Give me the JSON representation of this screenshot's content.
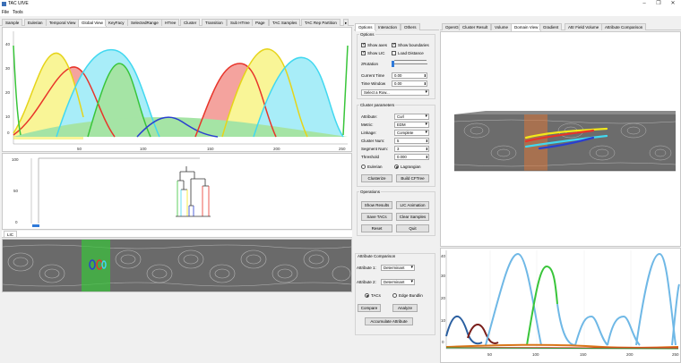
{
  "window": {
    "title": "TAC UIVE",
    "minimize": "–",
    "maximize": "❐",
    "close": "✕"
  },
  "menu": {
    "file": "File",
    "tools": "Tools"
  },
  "left_tabs": [
    "Sample",
    "Eulerian",
    "Temporal View",
    "Global View",
    "KeyFacy",
    "SelectedRange",
    "HTree",
    "Cluster",
    "Transition",
    "Sub HTree",
    "Page",
    "TAC Samples",
    "TAC Rep Partition"
  ],
  "left_tabs_more": "▸",
  "global_chart": {
    "y_ticks": [
      "40",
      "30",
      "20",
      "10",
      "0"
    ],
    "x_ticks": [
      "50",
      "100",
      "150",
      "200",
      "250"
    ]
  },
  "dendro_chart": {
    "y_ticks": [
      "100",
      "50",
      "0"
    ]
  },
  "lic": {
    "label": "LIC"
  },
  "options_tabs": [
    "Options",
    "Interaction",
    "Others"
  ],
  "options": {
    "group_title": "Options",
    "show_axes": "Show axes",
    "show_boundaries": "Show boundaries",
    "show_lic": "Show LIC",
    "load_distance": "Load Distance",
    "z_rotation_label": "zRotation",
    "current_time_label": "Current Time",
    "current_time_value": "0.00",
    "time_window_label": "Time Window",
    "time_window_value": "0.00",
    "select_row": "Select a Row..."
  },
  "cluster": {
    "group_title": "Cluster parameters",
    "attribute_label": "Attribute:",
    "attribute_value": "Curl",
    "metric_label": "Metric:",
    "metric_value": "EDM",
    "linkage_label": "Linkage:",
    "linkage_value": "Complete",
    "cluster_num_label": "Cluster Num:",
    "cluster_num_value": "5",
    "segment_num_label": "Segment Num:",
    "segment_num_value": "3",
    "threshold_label": "Threshold",
    "threshold_value": "0.000",
    "eulerian": "Eulerian",
    "lagrangian": "Lagrangian",
    "clusterize_btn": "Clusterize",
    "build_cftree_btn": "Build CFTree"
  },
  "operations": {
    "group_title": "Operations",
    "show_results": "Show Results",
    "lic_animation": "LIC Animation",
    "save_tacs": "Save TACs",
    "clear_samples": "Clear Samples",
    "reset": "Reset",
    "quit": "Quit"
  },
  "attr_comparison": {
    "group_title": "Attribute Comparison",
    "attribute1_label": "Attribute 1:",
    "attribute1_value": "Determinant",
    "attribute2_label": "Attribute 2:",
    "attribute2_value": "Determinant",
    "tacs": "TACs",
    "edge_bundling": "Edge Bundlin",
    "compare_btn": "Compare",
    "analyze_btn": "Analyze",
    "accumulate_btn": "Accumulate Attribute"
  },
  "right_tabs": [
    "OpenGL",
    "Cluster Result",
    "Volume",
    "Domain View",
    "Gradient",
    "Attr Field Volume",
    "Attribute Comparison"
  ],
  "attr_chart": {
    "y_ticks": [
      "40",
      "30",
      "20",
      "10",
      "0"
    ],
    "x_ticks": [
      "50",
      "100",
      "150",
      "200",
      "250"
    ]
  },
  "colors": {
    "red": "#e8342a",
    "yellow": "#f2e91a",
    "cyan": "#41d8f0",
    "green": "#39c53a",
    "blue": "#2a3fd0",
    "lightblue": "#6fb8e6",
    "darkred": "#7a1e1a",
    "darkblue": "#2a5fa0",
    "darkgreen": "#2f8c2f",
    "orange": "#d9761a",
    "accent": "#2f7ad9"
  }
}
